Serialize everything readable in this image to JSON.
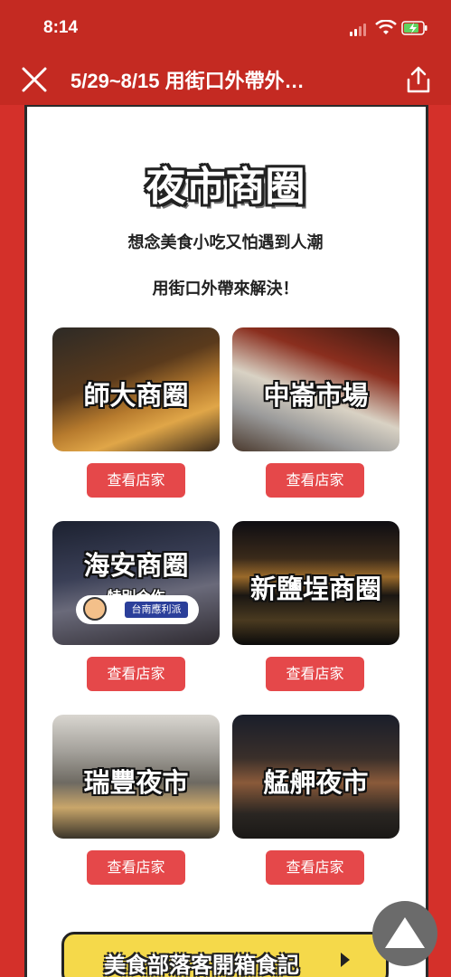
{
  "status": {
    "time": "8:14"
  },
  "nav": {
    "title": "5/29~8/15 用街口外帶外…"
  },
  "page": {
    "title": "夜市商圈",
    "subtitle1": "想念美食小吃又怕遇到人潮",
    "subtitle2": "用街口外帶來解決！"
  },
  "tiles": [
    {
      "label": "師大商圈",
      "button": "查看店家"
    },
    {
      "label": "中崙市場",
      "button": "查看店家"
    },
    {
      "label": "海安商圈",
      "note": "特別合作",
      "badge": "台南應利派",
      "button": "查看店家"
    },
    {
      "label": "新鹽埕商圈",
      "button": "查看店家"
    },
    {
      "label": "瑞豐夜市",
      "button": "查看店家"
    },
    {
      "label": "艋舺夜市",
      "button": "查看店家"
    }
  ],
  "banner": {
    "text": "美食部落客開箱食記"
  },
  "colors": {
    "red": "#c42a22",
    "button": "#e5484a",
    "banner": "#f5d94a"
  }
}
